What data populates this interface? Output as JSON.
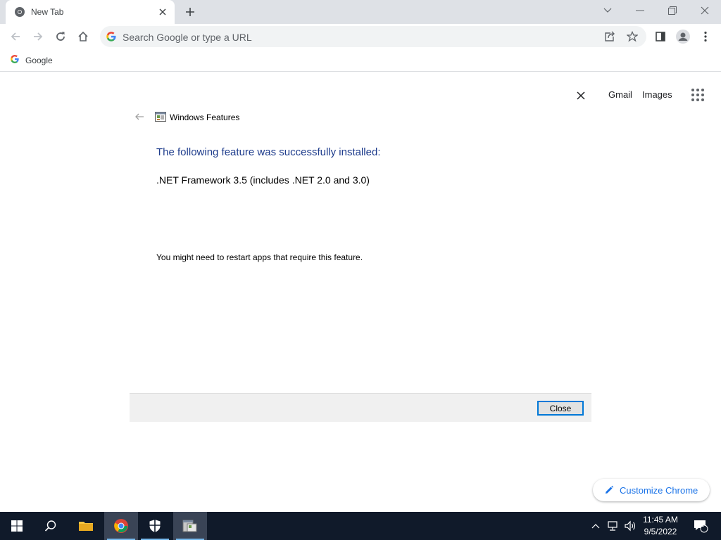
{
  "browser": {
    "tab": {
      "title": "New Tab"
    },
    "omnibox": {
      "placeholder": "Search Google or type a URL"
    },
    "bookmarks": [
      {
        "label": "Google"
      }
    ]
  },
  "ntp": {
    "links": {
      "gmail": "Gmail",
      "images": "Images"
    }
  },
  "dialog": {
    "title": "Windows Features",
    "heading": "The following feature was successfully installed:",
    "feature": ".NET Framework 3.5 (includes .NET 2.0 and 3.0)",
    "note": "You might need to restart apps that require this feature.",
    "close_label": "Close"
  },
  "customize": {
    "label": "Customize Chrome"
  },
  "taskbar": {
    "time": "11:45 AM",
    "date": "9/5/2022",
    "notification_count": "1"
  },
  "colors": {
    "accent": "#1a73e8",
    "dialog_heading": "#1e3c8c",
    "taskbar": "#101a2a",
    "focus_border": "#0078d7"
  }
}
